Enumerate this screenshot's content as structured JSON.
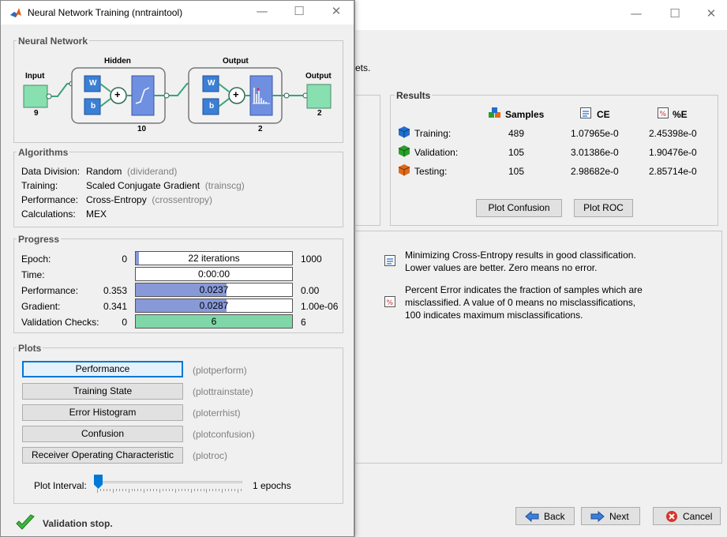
{
  "background_window": {
    "partial_text": "ets.",
    "results": {
      "title": "Results",
      "headers": {
        "samples": "Samples",
        "ce": "CE",
        "pe": "%E"
      },
      "rows": [
        {
          "label": "Training:",
          "samples": "489",
          "ce": "1.07965e-0",
          "pe": "2.45398e-0",
          "color": "#1f6fd0"
        },
        {
          "label": "Validation:",
          "samples": "105",
          "ce": "3.01386e-0",
          "pe": "1.90476e-0",
          "color": "#2aa02a"
        },
        {
          "label": "Testing:",
          "samples": "105",
          "ce": "2.98682e-0",
          "pe": "2.85714e-0",
          "color": "#e06a1a"
        }
      ],
      "plot_confusion": "Plot Confusion",
      "plot_roc": "Plot ROC"
    },
    "info": {
      "ce_line1": "Minimizing Cross-Entropy results in good classification.",
      "ce_line2": "Lower values are better. Zero means no error.",
      "pe_line1": "Percent Error  indicates the fraction of samples which are",
      "pe_line2": "misclassified. A value of 0 means no misclassifications,",
      "pe_line3": "100 indicates maximum misclassifications."
    },
    "buttons": {
      "back": "Back",
      "next": "Next",
      "cancel": "Cancel"
    }
  },
  "window": {
    "title": "Neural Network Training (nntraintool)",
    "network": {
      "section_title": "Neural Network",
      "input_label": "Input",
      "input_size": "9",
      "hidden_label": "Hidden",
      "hidden_size": "10",
      "output_layer_label": "Output",
      "output_layer_size": "2",
      "output_label": "Output",
      "output_size": "2",
      "w": "W",
      "b": "b",
      "plus": "+"
    },
    "algorithms": {
      "title": "Algorithms",
      "rows": [
        {
          "label": "Data Division:",
          "value": "Random",
          "fn": "(dividerand)"
        },
        {
          "label": "Training:",
          "value": "Scaled Conjugate Gradient",
          "fn": "(trainscg)"
        },
        {
          "label": "Performance:",
          "value": "Cross-Entropy",
          "fn": "(crossentropy)"
        },
        {
          "label": "Calculations:",
          "value": "MEX",
          "fn": ""
        }
      ]
    },
    "progress": {
      "title": "Progress",
      "rows": [
        {
          "label": "Epoch:",
          "start": "0",
          "text": "22 iterations",
          "end": "1000",
          "fill": 0.02,
          "color": "#8899d8"
        },
        {
          "label": "Time:",
          "start": "",
          "text": "0:00:00",
          "end": "",
          "fill": 0,
          "color": "#8899d8"
        },
        {
          "label": "Performance:",
          "start": "0.353",
          "text": "0.0237",
          "end": "0.00",
          "fill": 0.58,
          "color": "#8899d8"
        },
        {
          "label": "Gradient:",
          "start": "0.341",
          "text": "0.0287",
          "end": "1.00e-06",
          "fill": 0.58,
          "color": "#8899d8"
        },
        {
          "label": "Validation Checks:",
          "start": "0",
          "text": "6",
          "end": "6",
          "fill": 1.0,
          "color": "#7fd7a7"
        }
      ]
    },
    "plots": {
      "title": "Plots",
      "buttons": [
        {
          "label": "Performance",
          "fn": "(plotperform)"
        },
        {
          "label": "Training State",
          "fn": "(plottrainstate)"
        },
        {
          "label": "Error Histogram",
          "fn": "(ploterrhist)"
        },
        {
          "label": "Confusion",
          "fn": "(plotconfusion)"
        },
        {
          "label": "Receiver Operating Characteristic",
          "fn": "(plotroc)"
        }
      ],
      "interval_label": "Plot Interval:",
      "interval_value": "1 epochs",
      "slider_fraction": 0.0
    },
    "status": "Validation stop."
  }
}
